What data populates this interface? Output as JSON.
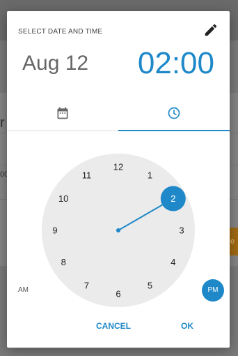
{
  "dialog": {
    "title": "SELECT DATE AND TIME",
    "edit_icon": "pencil-icon",
    "date": "Aug 12",
    "time": "02:00"
  },
  "tabs": [
    {
      "name": "date",
      "icon": "calendar-icon",
      "active": false
    },
    {
      "name": "time",
      "icon": "clock-icon",
      "active": true
    }
  ],
  "clock": {
    "numbers": [
      "12",
      "1",
      "2",
      "3",
      "4",
      "5",
      "6",
      "7",
      "8",
      "9",
      "10",
      "11"
    ],
    "selected_hour": "2"
  },
  "ampm": {
    "am_label": "AM",
    "pm_label": "PM",
    "selected": "PM"
  },
  "actions": {
    "cancel_label": "CANCEL",
    "ok_label": "OK"
  },
  "colors": {
    "accent": "#1e88c8",
    "clock_face": "#ebebeb",
    "text_primary": "#222222",
    "text_secondary": "#666666"
  },
  "background": {
    "partial_text_1": "r",
    "partial_text_2": "00",
    "partial_text_3": "e"
  }
}
